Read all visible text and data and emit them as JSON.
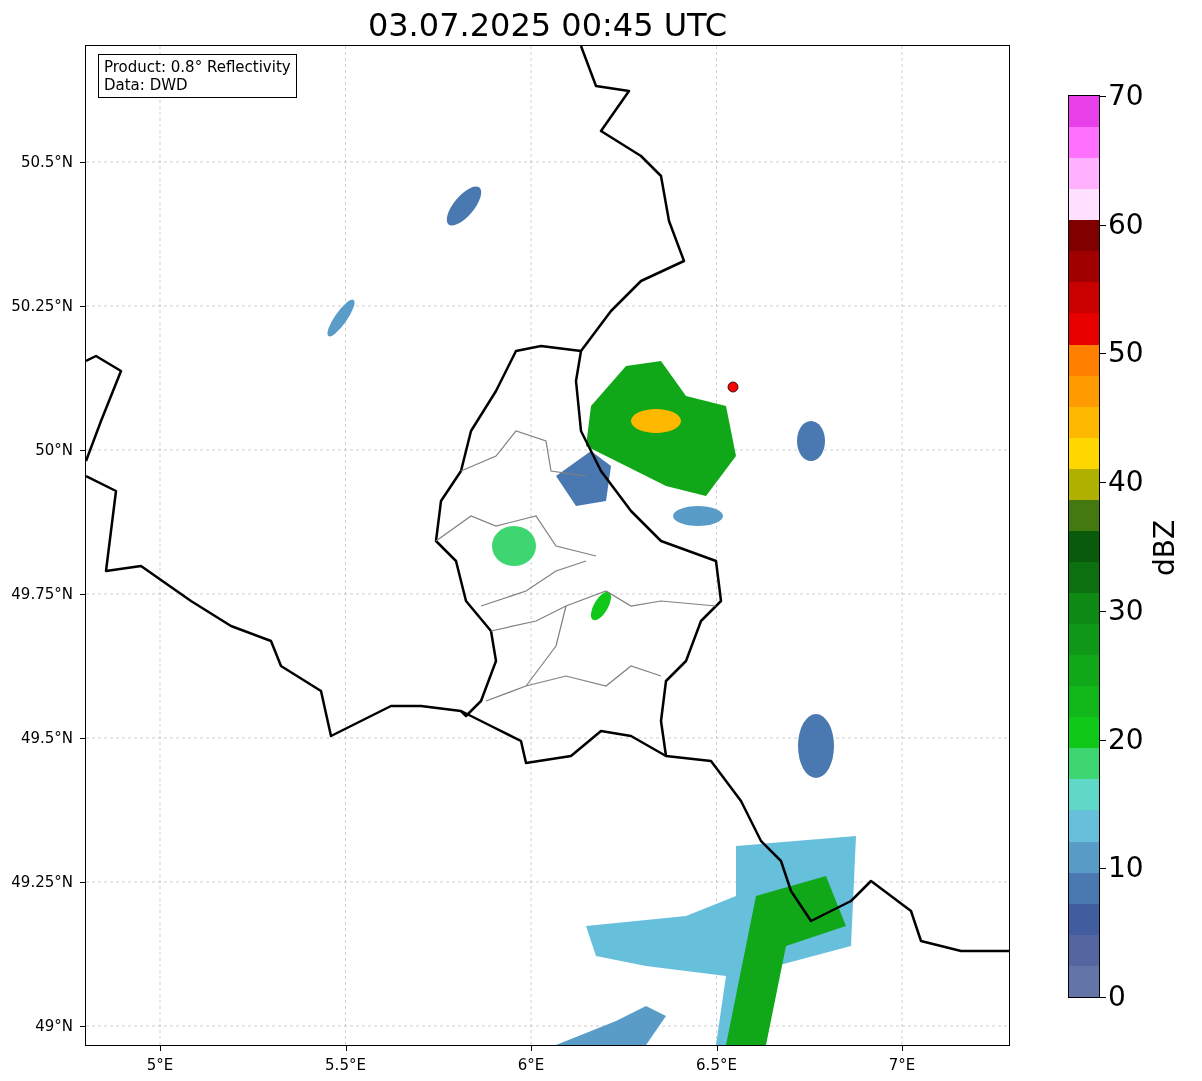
{
  "title": "03.07.2025 00:45 UTC",
  "info_box": {
    "lines": [
      "Product: 0.8° Reflectivity",
      "Data: DWD"
    ]
  },
  "x_ticks": [
    "5°E",
    "5.5°E",
    "6°E",
    "6.5°E",
    "7°E"
  ],
  "y_ticks": [
    "50.5°N",
    "50.25°N",
    "50°N",
    "49.75°N",
    "49.5°N",
    "49.25°N",
    "49°N"
  ],
  "colorbar": {
    "label": "dBZ",
    "ticks": [
      "70",
      "60",
      "50",
      "40",
      "30",
      "20",
      "10",
      "0"
    ],
    "bands": [
      {
        "color": "#e840e8"
      },
      {
        "color": "#ff70ff"
      },
      {
        "color": "#ffb0ff"
      },
      {
        "color": "#ffe0ff"
      },
      {
        "color": "#800000"
      },
      {
        "color": "#a00000"
      },
      {
        "color": "#c80000"
      },
      {
        "color": "#e80000"
      },
      {
        "color": "#ff7f00"
      },
      {
        "color": "#ff9a00"
      },
      {
        "color": "#ffb800"
      },
      {
        "color": "#ffd700"
      },
      {
        "color": "#b0b000"
      },
      {
        "color": "#447810"
      },
      {
        "color": "#0a5a0c"
      },
      {
        "color": "#0c7010"
      },
      {
        "color": "#0e8a14"
      },
      {
        "color": "#109818"
      },
      {
        "color": "#10a818"
      },
      {
        "color": "#12b81a"
      },
      {
        "color": "#10c818"
      },
      {
        "color": "#3ed670"
      },
      {
        "color": "#60d8c8"
      },
      {
        "color": "#66c0dc"
      },
      {
        "color": "#5a9cc8"
      },
      {
        "color": "#4a78b0"
      },
      {
        "color": "#425ca0"
      },
      {
        "color": "#5466a0"
      },
      {
        "color": "#6374a6"
      }
    ]
  }
}
